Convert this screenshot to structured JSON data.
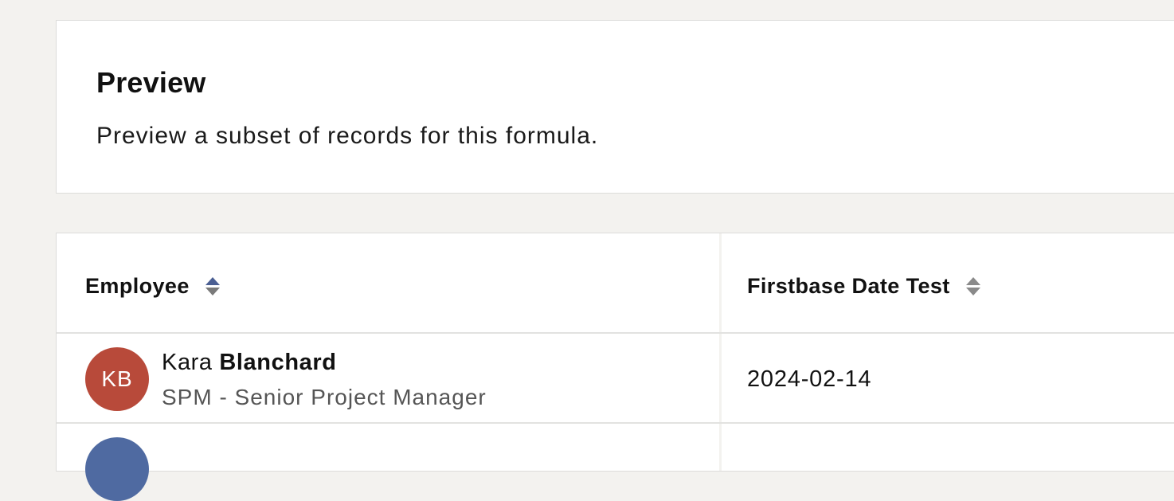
{
  "preview": {
    "title": "Preview",
    "description": "Preview a subset of records for this formula."
  },
  "table": {
    "columns": [
      {
        "label": "Employee",
        "sort_icon": "sort-icon",
        "sort_state": "ascending"
      },
      {
        "label": "Firstbase Date Test",
        "sort_icon": "sort-icon",
        "sort_state": "none"
      }
    ],
    "rows": [
      {
        "initials": "KB",
        "first_name": "Kara",
        "last_name": "Blanchard",
        "role": "SPM - Senior Project Manager",
        "date": "2024-02-14",
        "avatar_color": "#b84a3a"
      },
      {
        "initials": "",
        "first_name": "",
        "last_name": "",
        "role": "",
        "date": "",
        "avatar_color": "#4f6aa1"
      }
    ]
  },
  "colors": {
    "page_background": "#f3f2ef",
    "card_background": "#ffffff",
    "sort_active": "#4b5f93",
    "secondary_text": "#555555"
  }
}
